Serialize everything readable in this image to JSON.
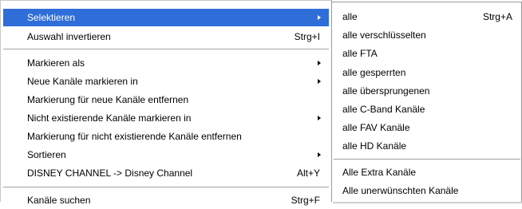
{
  "main_menu": {
    "items": [
      {
        "label": "Selektieren",
        "shortcut": ""
      },
      {
        "label": "Auswahl invertieren",
        "shortcut": "Strg+I"
      },
      {
        "label": "Markieren als",
        "shortcut": ""
      },
      {
        "label": "Neue Kanäle markieren in",
        "shortcut": ""
      },
      {
        "label": "Markierung für neue Kanäle entfernen",
        "shortcut": ""
      },
      {
        "label": "Nicht existierende Kanäle markieren in",
        "shortcut": ""
      },
      {
        "label": "Markierung für nicht existierende Kanäle entfernen",
        "shortcut": ""
      },
      {
        "label": "Sortieren",
        "shortcut": ""
      },
      {
        "label": "DISNEY CHANNEL -> Disney Channel",
        "shortcut": "Alt+Y"
      },
      {
        "label": "Kanäle suchen",
        "shortcut": "Strg+F"
      }
    ],
    "highlight_color": "#2f6ed8"
  },
  "sub_menu": {
    "items": [
      {
        "label": "alle",
        "shortcut": "Strg+A"
      },
      {
        "label": "alle verschlüsselten",
        "shortcut": ""
      },
      {
        "label": "alle FTA",
        "shortcut": ""
      },
      {
        "label": "alle gesperrten",
        "shortcut": ""
      },
      {
        "label": "alle übersprungenen",
        "shortcut": ""
      },
      {
        "label": "alle C-Band Kanäle",
        "shortcut": ""
      },
      {
        "label": "alle FAV Kanäle",
        "shortcut": ""
      },
      {
        "label": "alle HD Kanäle",
        "shortcut": ""
      },
      {
        "label": "Alle Extra Kanäle",
        "shortcut": ""
      },
      {
        "label": "Alle unerwünschten Kanäle",
        "shortcut": ""
      }
    ]
  }
}
